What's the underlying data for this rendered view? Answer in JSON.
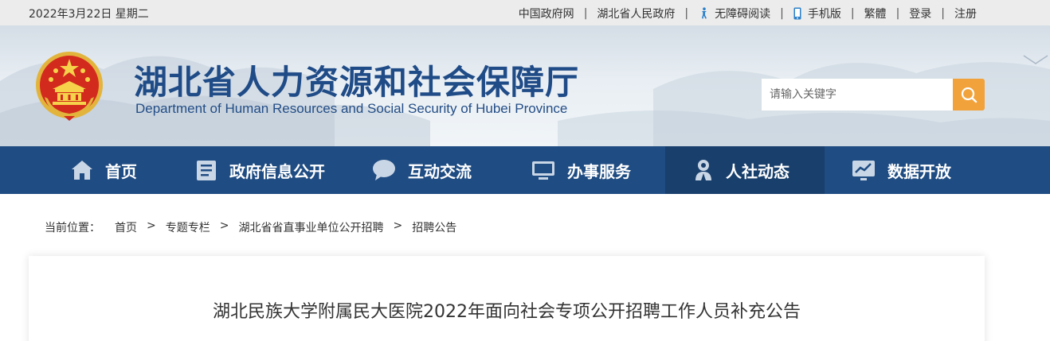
{
  "topbar": {
    "date": "2022年3月22日 星期二",
    "links": {
      "gov": "中国政府网",
      "province": "湖北省人民政府",
      "accessible": "无障碍阅读",
      "mobile": "手机版",
      "traditional": "繁體",
      "login": "登录",
      "register": "注册"
    },
    "separator": "|"
  },
  "header": {
    "title": "湖北省人力资源和社会保障厅",
    "subtitle": "Department of Human Resources and Social Security of Hubei Province",
    "search_placeholder": "请输入关键字"
  },
  "nav": {
    "items": [
      {
        "label": "首页",
        "icon": "home-icon"
      },
      {
        "label": "政府信息公开",
        "icon": "document-icon"
      },
      {
        "label": "互动交流",
        "icon": "chat-icon"
      },
      {
        "label": "办事服务",
        "icon": "monitor-icon"
      },
      {
        "label": "人社动态",
        "icon": "person-icon",
        "active": true
      },
      {
        "label": "数据开放",
        "icon": "chart-icon"
      }
    ]
  },
  "breadcrumb": {
    "lead": "当前位置：",
    "items": [
      "首页",
      "专题专栏",
      "湖北省省直事业单位公开招聘",
      "招聘公告"
    ],
    "separator": ">"
  },
  "article": {
    "title": "湖北民族大学附属民大医院2022年面向社会专项公开招聘工作人员补充公告"
  },
  "colors": {
    "nav_bg": "#1f4c82",
    "nav_active": "#193f6c",
    "title_blue": "#1f4b87",
    "search_button": "#f2a23a"
  }
}
